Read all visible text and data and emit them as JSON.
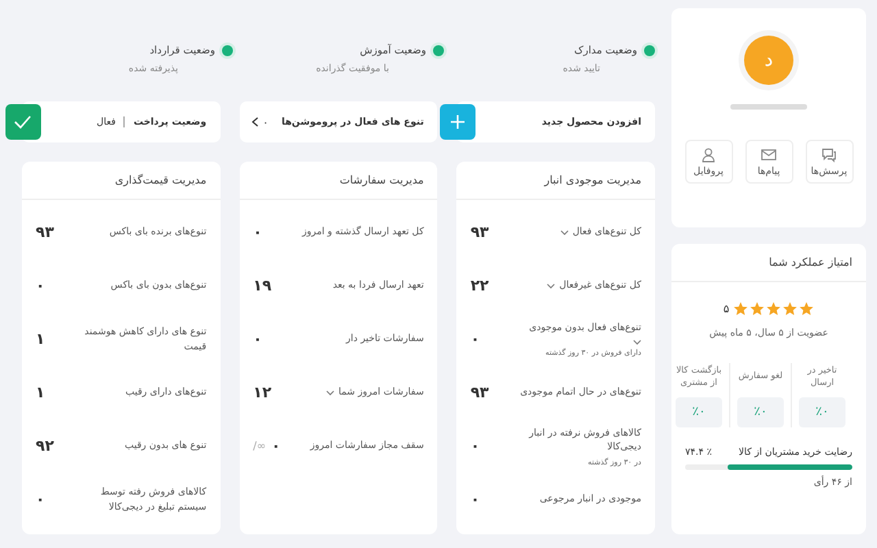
{
  "profile": {
    "avatar_letter": "د",
    "buttons": [
      {
        "kind": "questions",
        "label": "پرسش‌ها"
      },
      {
        "kind": "messages",
        "label": "پیام‌ها"
      },
      {
        "kind": "profile",
        "label": "پروفایل"
      }
    ]
  },
  "performance": {
    "title": "امتیاز عملکرد شما",
    "stars": 5,
    "rating": "۵",
    "membership": "عضویت از ۵ سال، ۵ ماه پیش",
    "metrics": [
      {
        "label": "تاخیر در ارسال",
        "value": "٪۰"
      },
      {
        "label": "لغو سفارش",
        "value": "٪۰"
      },
      {
        "label": "بازگشت کالا از مشتری",
        "value": "٪۰"
      }
    ],
    "satisfaction": {
      "label": "رضایت خرید مشتریان از کالا",
      "reading": "٪ ۷۴.۴",
      "level": 0.744,
      "votes": "از ۴۶ رأی"
    }
  },
  "statuses": [
    {
      "label": "وضعیت مدارک",
      "value": "تایید شده"
    },
    {
      "label": "وضعیت آموزش",
      "value": "با موفقیت گذرانده"
    },
    {
      "label": "وضعیت قرارداد",
      "value": "پذیرفته شده"
    }
  ],
  "actions": [
    {
      "kind": "add",
      "label": "افزودن محصول جدید"
    },
    {
      "kind": "count",
      "label": "تنوع های فعال در پروموشن‌ها",
      "value": "۰"
    },
    {
      "kind": "status",
      "label": "وضعیت پرداخت",
      "value": "فعال"
    }
  ],
  "panels": [
    {
      "title": "مدیریت موجودی انبار",
      "rows": [
        {
          "label": "کل تنوع‌های فعال",
          "dropdown": true,
          "value": "۹۳"
        },
        {
          "label": "کل تنوع‌های غیرفعال",
          "dropdown": true,
          "value": "۲۲"
        },
        {
          "label": "تنوع‌های فعال بدون موجودی",
          "dropdown": true,
          "note": "دارای فروش در ۳۰ روز گذشته",
          "value": "۰"
        },
        {
          "label": "تنوع‌های در حال اتمام موجودی",
          "dropdown": false,
          "value": "۹۳"
        },
        {
          "label": "کالاهای فروش نرفته در انبار دیجی‌کالا",
          "dropdown": false,
          "note": "در ۳۰ روز گذشته",
          "value": "۰"
        },
        {
          "label": "موجودی در انبار مرجوعی",
          "dropdown": false,
          "value": "۰"
        }
      ]
    },
    {
      "title": "مدیریت سفارشات",
      "rows": [
        {
          "label": "کل تعهد ارسال گذشته و امروز",
          "dropdown": false,
          "value": "۰"
        },
        {
          "label": "تعهد ارسال فردا به بعد",
          "dropdown": false,
          "value": "۱۹"
        },
        {
          "label": "سفارشات تاخیر دار",
          "dropdown": false,
          "value": "۰"
        },
        {
          "label": "سفارشات امروز شما",
          "dropdown": true,
          "value": "۱۲"
        },
        {
          "label": "سقف مجاز سفارشات امروز",
          "dropdown": false,
          "value": "۰",
          "limit": "/∞"
        }
      ]
    },
    {
      "title": "مدیریت قیمت‌گذاری",
      "rows": [
        {
          "label": "تنوع‌های برنده بای باکس",
          "dropdown": false,
          "value": "۹۳"
        },
        {
          "label": "تنوع‌های بدون بای باکس",
          "dropdown": false,
          "value": "۰"
        },
        {
          "label": "تنوع های دارای کاهش هوشمند قیمت",
          "dropdown": false,
          "value": "۱"
        },
        {
          "label": "تنوع‌های دارای رقیب",
          "dropdown": false,
          "value": "۱"
        },
        {
          "label": "تنوع های بدون رقیب",
          "dropdown": false,
          "value": "۹۲"
        },
        {
          "label": "کالاهای فروش رفته توسط سیستم تبلیغ در دیجی‌کالا",
          "dropdown": false,
          "value": "۰"
        }
      ]
    }
  ]
}
